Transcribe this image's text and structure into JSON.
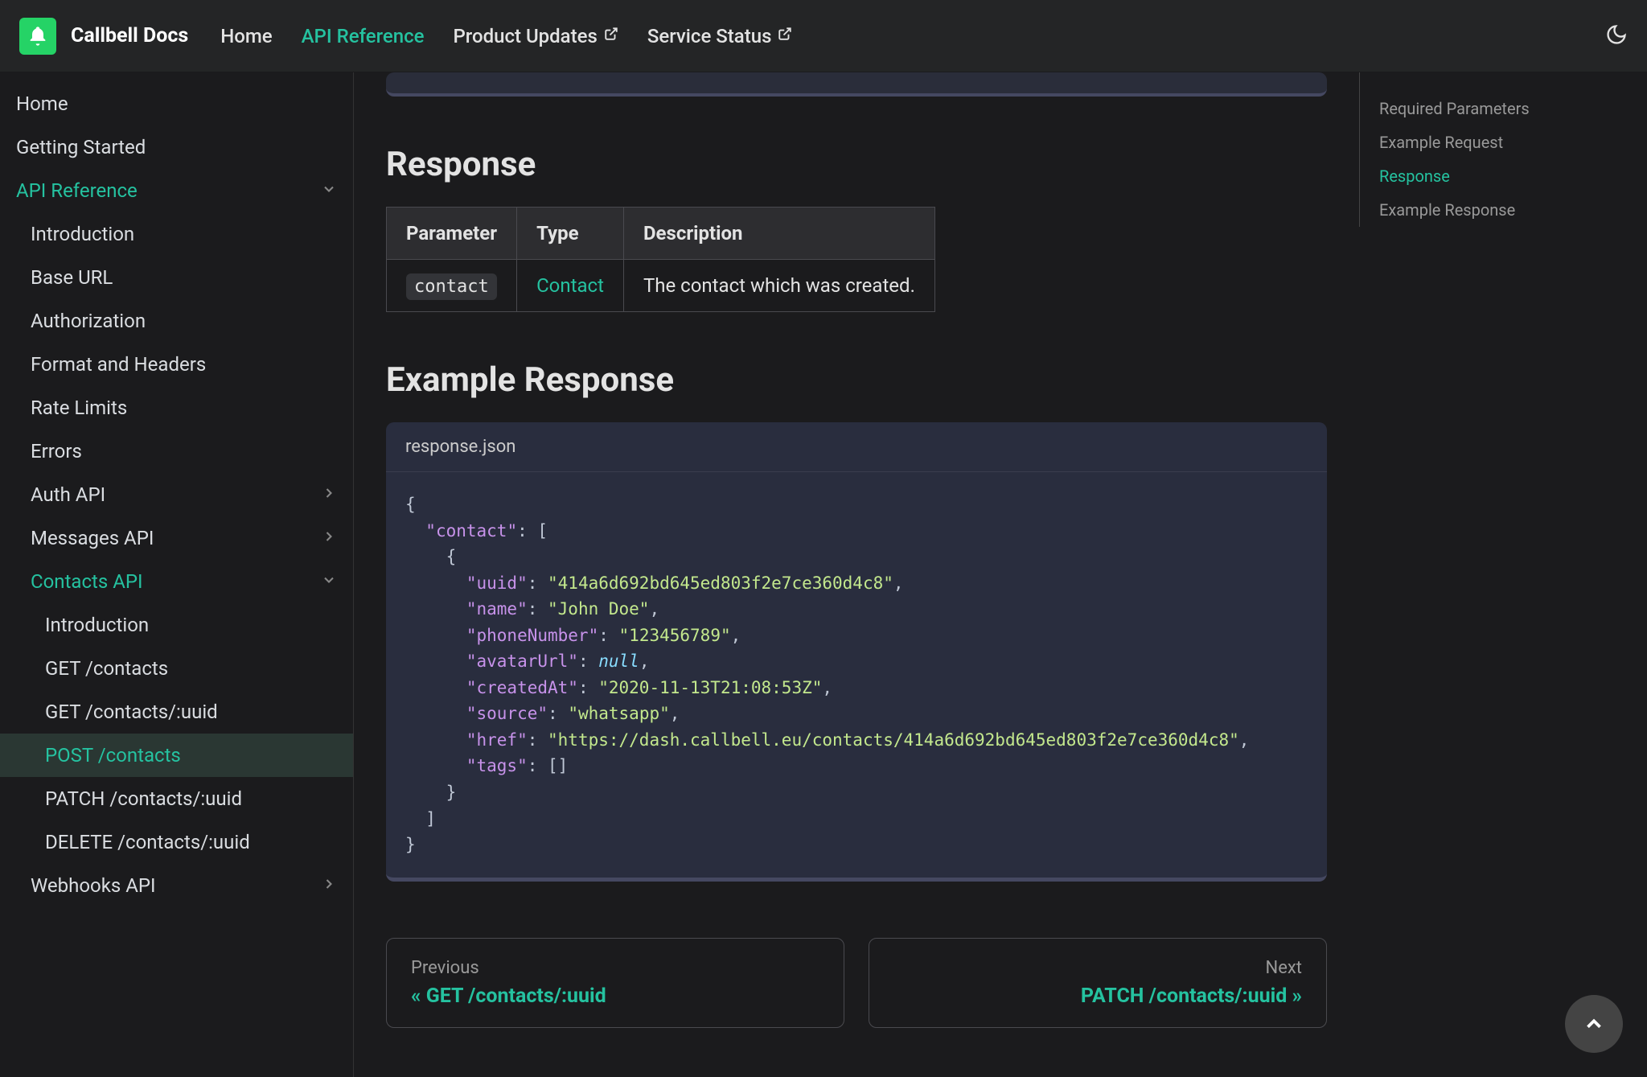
{
  "brand": "Callbell Docs",
  "nav": {
    "home": "Home",
    "api_reference": "API Reference",
    "product_updates": "Product Updates",
    "service_status": "Service Status"
  },
  "sidebar": {
    "home": "Home",
    "getting_started": "Getting Started",
    "api_reference": "API Reference",
    "introduction": "Introduction",
    "base_url": "Base URL",
    "authorization": "Authorization",
    "format_headers": "Format and Headers",
    "rate_limits": "Rate Limits",
    "errors": "Errors",
    "auth_api": "Auth API",
    "messages_api": "Messages API",
    "contacts_api": "Contacts API",
    "contacts_intro": "Introduction",
    "get_contacts": "GET /contacts",
    "get_contacts_uuid": "GET /contacts/:uuid",
    "post_contacts": "POST /contacts",
    "patch_contacts_uuid": "PATCH /contacts/:uuid",
    "delete_contacts_uuid": "DELETE /contacts/:uuid",
    "webhooks_api": "Webhooks API"
  },
  "toc": {
    "required_params": "Required Parameters",
    "example_request": "Example Request",
    "response": "Response",
    "example_response": "Example Response"
  },
  "content": {
    "response_heading": "Response",
    "table": {
      "h_param": "Parameter",
      "h_type": "Type",
      "h_desc": "Description",
      "r_param": "contact",
      "r_type": "Contact",
      "r_desc": "The contact which was created."
    },
    "example_response_heading": "Example Response",
    "code_filename": "response.json",
    "json": {
      "k_contact": "\"contact\"",
      "k_uuid": "\"uuid\"",
      "v_uuid": "\"414a6d692bd645ed803f2e7ce360d4c8\"",
      "k_name": "\"name\"",
      "v_name": "\"John Doe\"",
      "k_phone": "\"phoneNumber\"",
      "v_phone": "\"123456789\"",
      "k_avatar": "\"avatarUrl\"",
      "v_avatar": "null",
      "k_created": "\"createdAt\"",
      "v_created": "\"2020-11-13T21:08:53Z\"",
      "k_source": "\"source\"",
      "v_source": "\"whatsapp\"",
      "k_href": "\"href\"",
      "v_href": "\"https://dash.callbell.eu/contacts/414a6d692bd645ed803f2e7ce360d4c8\"",
      "k_tags": "\"tags\""
    }
  },
  "pagination": {
    "prev_label": "Previous",
    "prev_title": "« GET /contacts/:uuid",
    "next_label": "Next",
    "next_title": "PATCH /contacts/:uuid »"
  }
}
